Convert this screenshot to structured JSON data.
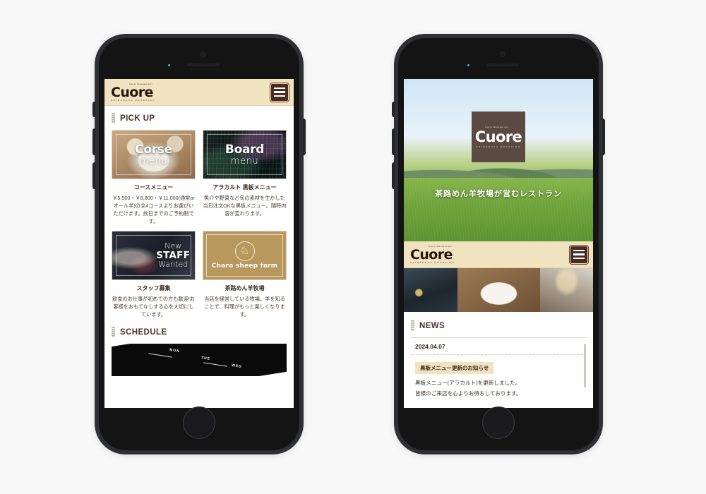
{
  "page": {
    "background": "#f8f8f8"
  },
  "brand": {
    "logo_sup": "Farm Restaurant",
    "logo_main": "Cuore",
    "logo_sub": "SHIRANUKA HOKKAIDO",
    "accent_cream": "#f2e3c0",
    "accent_brown": "#4a2b22",
    "gold": "#b8985c"
  },
  "left_phone": {
    "name": "iPhone mockup showing PICK UP page",
    "header": {
      "menu_label": "menu"
    },
    "pickup": {
      "heading": "PICK UP",
      "cards": [
        {
          "overlay_main": "Corse",
          "overlay_sub": "menu",
          "title": "コースメニュー",
          "desc": "￥5,500・￥8,800・￥11,000(通常orオール羊)の全4コースよりお選びいただけます。前日までのご予約制です。"
        },
        {
          "overlay_main": "Board",
          "overlay_sub": "menu",
          "title": "アラカルト 黒板メニュー",
          "desc": "魚介や野菜など旬の素材を生かした当日注文OKな黒板メニュー。随時内容が変わります。"
        },
        {
          "overlay_line1": "New",
          "overlay_line2": "STAFF",
          "overlay_line3": "Wanted",
          "title": "スタッフ募集",
          "desc": "飲食のお仕事が初めての方も歓迎!お客様をおもてなしする心を大切にしています。"
        },
        {
          "farm_name": "Charo sheep farm",
          "title": "茶路めん羊牧場",
          "desc": "当店を経営している牧場。羊を知ることで、料理がもっと楽しくなります。"
        }
      ]
    },
    "schedule": {
      "heading": "SCHEDULE",
      "days": [
        "MON",
        "TUE",
        "WED"
      ]
    }
  },
  "right_phone": {
    "name": "iPhone mockup showing top page with hero and NEWS",
    "hero": {
      "caption": "茶路めん羊牧場が営むレストラン"
    },
    "header": {
      "menu_label": "menu"
    },
    "gallery": [
      {
        "alt": "restaurant exterior at dusk"
      },
      {
        "alt": "tomato stew dish in white bowl"
      },
      {
        "alt": "restaurant interior with wooden tables"
      }
    ],
    "news": {
      "heading": "NEWS",
      "date": "2024.04.07",
      "badge": "黒板メニュー更新のお知らせ",
      "line1": "黒板メニュー(アラカルト)を更新しました。",
      "line2": "皆様のご来店を心よりお待ちしております。"
    }
  }
}
